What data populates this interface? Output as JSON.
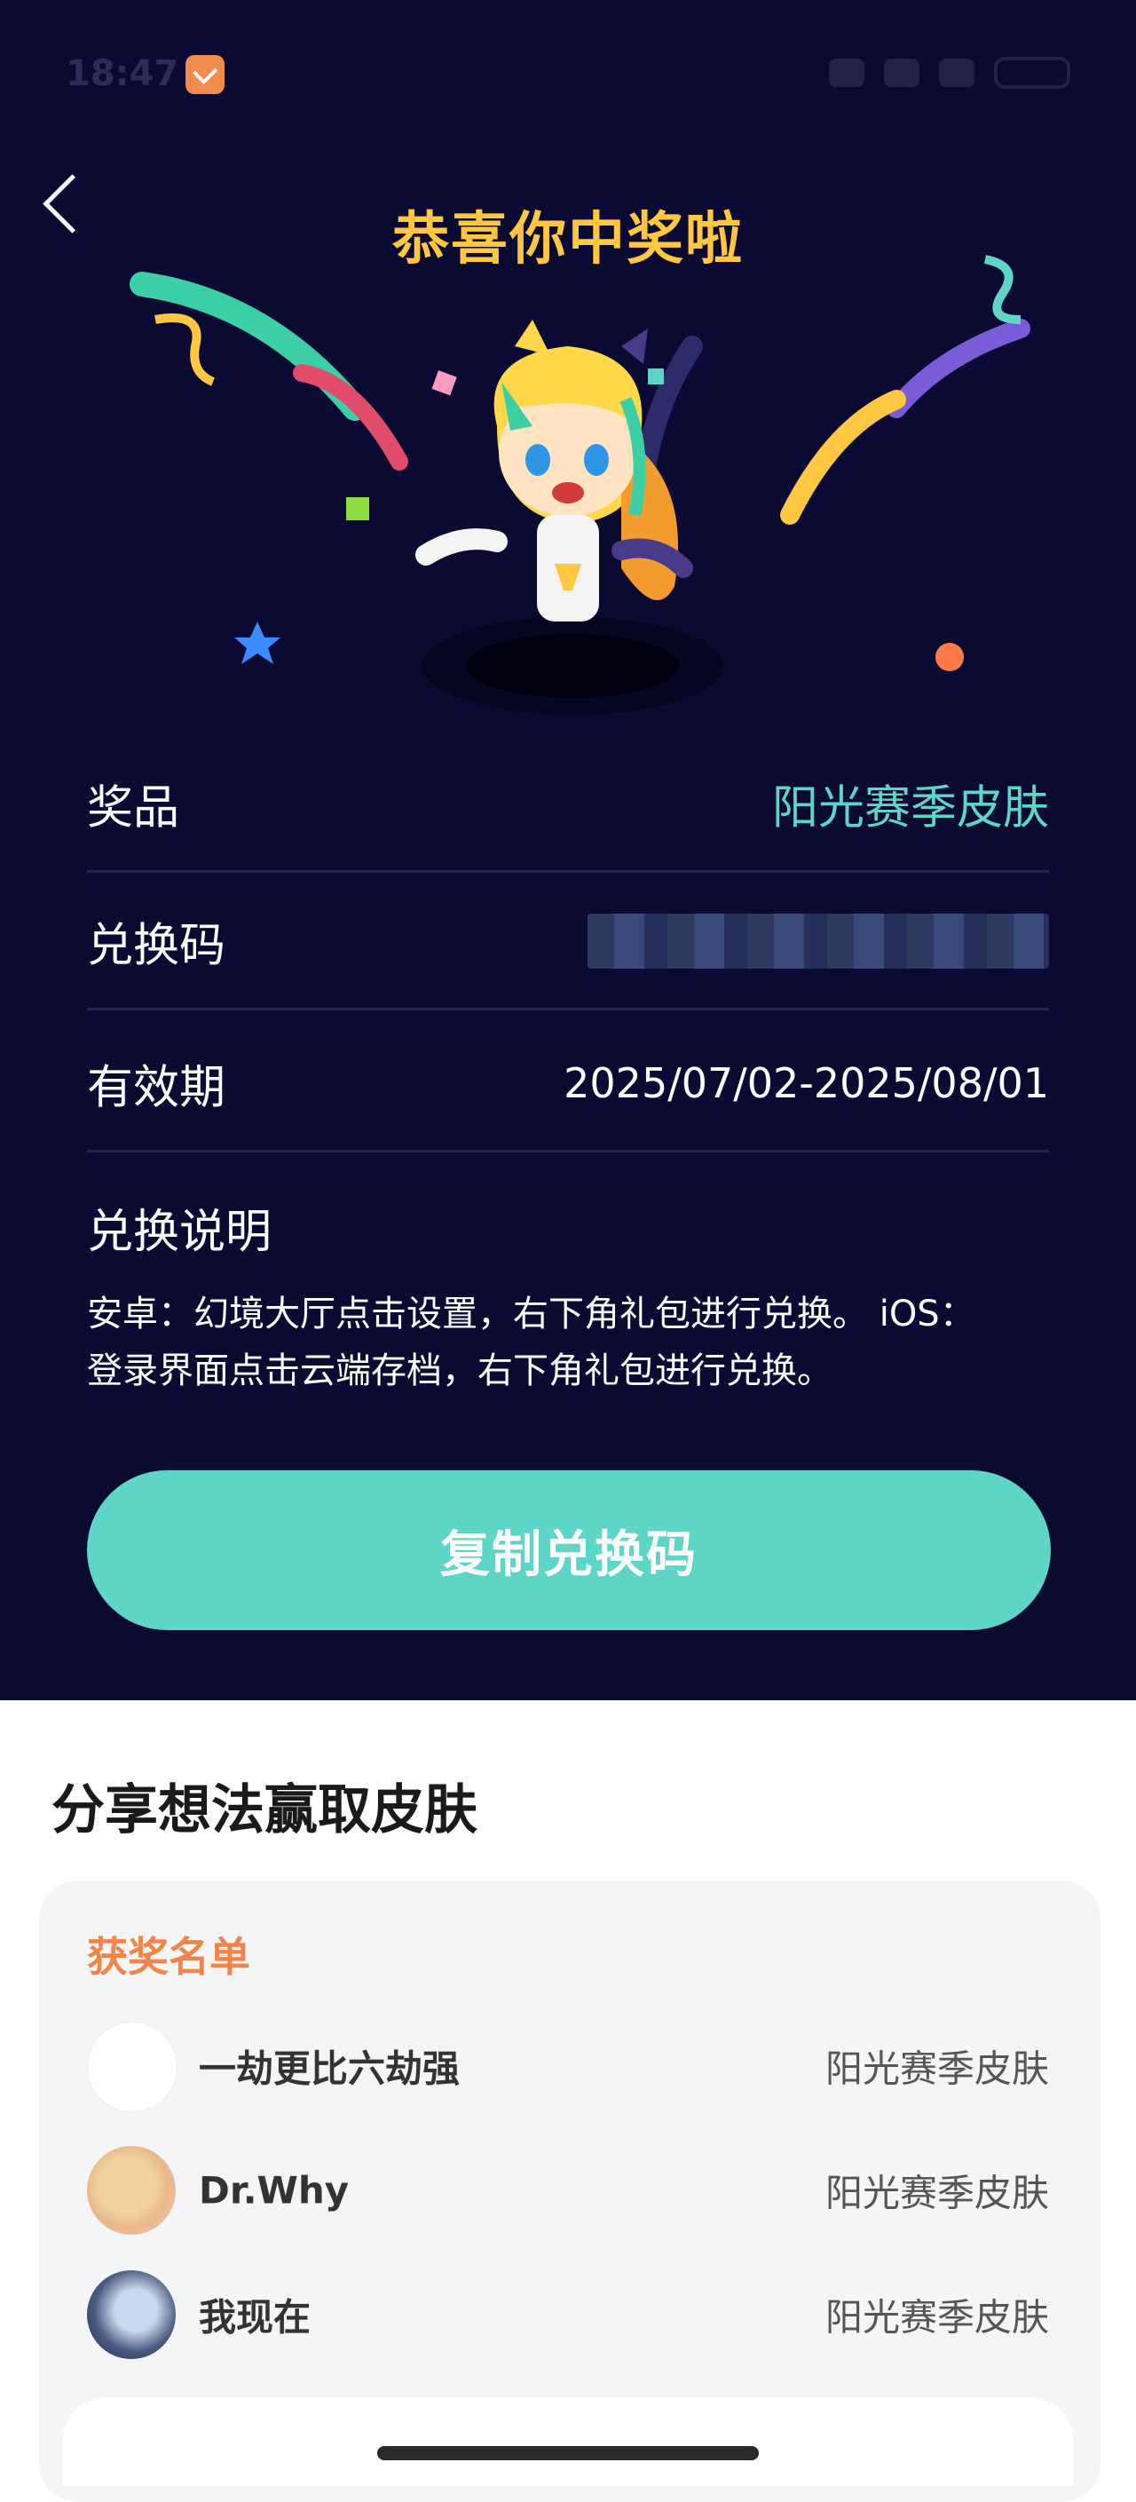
{
  "status": {
    "time": "18:47"
  },
  "header": {
    "title": "恭喜你中奖啦"
  },
  "details": {
    "prize_label": "奖品",
    "prize_value": "阳光赛季皮肤",
    "code_label": "兑换码",
    "validity_label": "有效期",
    "validity_value": "2025/07/02-2025/08/01",
    "instructions_label": "兑换说明",
    "instructions_line1": "安卓：幻境大厅点击设置，右下角礼包进行兑换。 iOS：",
    "instructions_line2": "登录界面点击云端存档，右下角礼包进行兑换。"
  },
  "copy_button": {
    "label": "复制兑换码"
  },
  "share": {
    "title": "分享想法赢取皮肤",
    "winners_title": "获奖名单",
    "winners": [
      {
        "name": "一劫更比六劫强",
        "prize": "阳光赛季皮肤"
      },
      {
        "name": "Dr.Why",
        "prize": "阳光赛季皮肤"
      },
      {
        "name": "我现在",
        "prize": "阳光赛季皮肤"
      }
    ]
  },
  "colors": {
    "hero_bg": "#0b0a33",
    "title": "#ffc840",
    "accent": "#5ed6c7",
    "winners_title": "#f2844a"
  }
}
